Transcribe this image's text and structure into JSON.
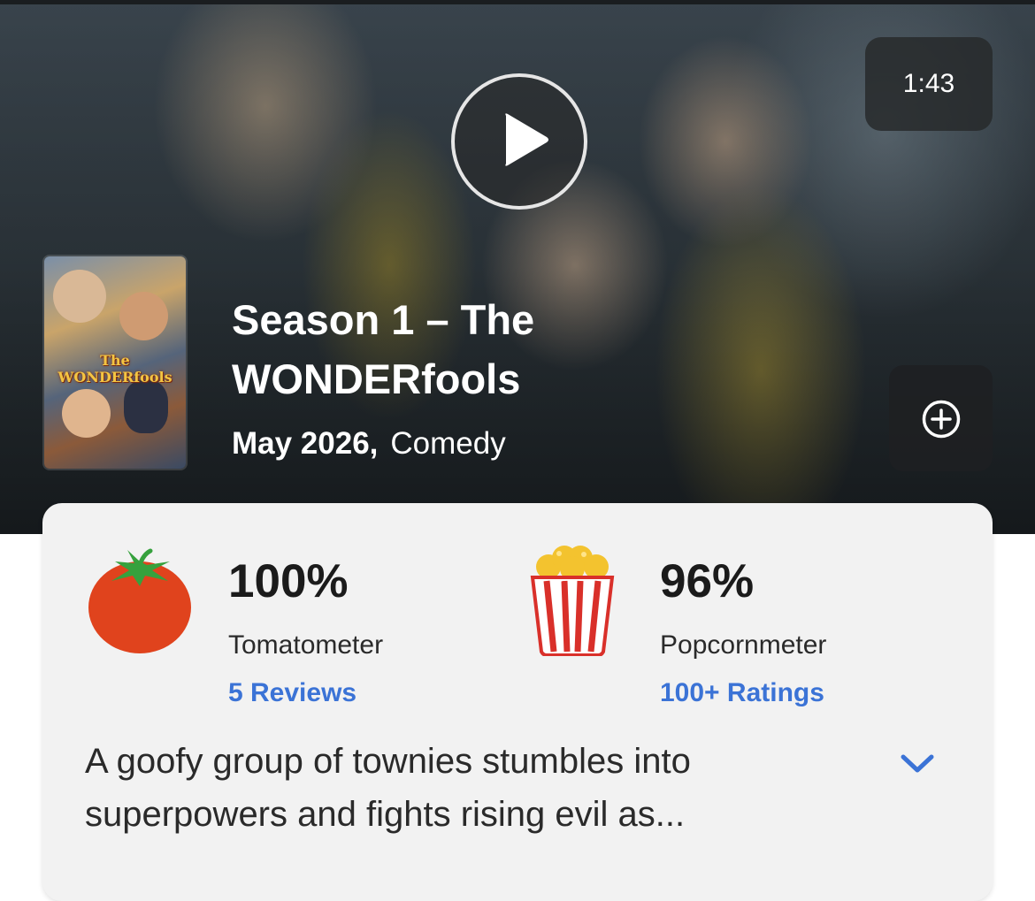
{
  "hero": {
    "duration": "1:43",
    "title": "Season 1 – The WONDERfools",
    "release_date": "May 2026,",
    "genre": "Comedy",
    "poster_logo": "The WONDERfools"
  },
  "ratings": {
    "tomatometer": {
      "score": "100%",
      "label": "Tomatometer",
      "link": "5 Reviews"
    },
    "popcornmeter": {
      "score": "96%",
      "label": "Popcornmeter",
      "link": "100+ Ratings"
    }
  },
  "synopsis": {
    "text": "A goofy group of townies stumbles into superpowers and fights rising evil as..."
  },
  "icons": {
    "play": "play-icon",
    "add": "add-circle-icon",
    "tomato": "tomato-icon",
    "popcorn": "popcorn-icon",
    "expand": "chevron-down-icon"
  },
  "colors": {
    "accent_link": "#3b73d6",
    "tomato_red": "#e0431d",
    "popcorn_red": "#d9302a"
  }
}
